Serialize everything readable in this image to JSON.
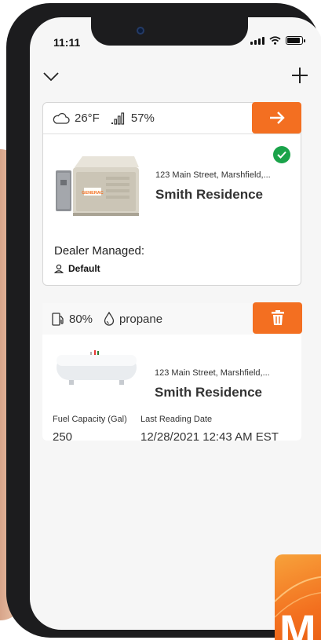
{
  "status_bar": {
    "time": "11:11"
  },
  "nav": {
    "collapse_icon": "chevron-down-icon",
    "add_icon": "plus-icon"
  },
  "generator_card": {
    "weather_icon": "cloud-icon",
    "temperature": "26°F",
    "signal_icon": "signal-bars-icon",
    "signal_strength": "57%",
    "action_icon": "arrow-right-icon",
    "address": "123 Main Street, Marshfield,...",
    "residence": "Smith Residence",
    "status_icon": "check-circle-icon",
    "brand_text": "GENERAC",
    "dealer_label": "Dealer Managed:",
    "dealer_value": "Default",
    "dealer_icon": "user-icon"
  },
  "fuel_card": {
    "fuel_icon": "fuel-pump-icon",
    "fuel_level": "80%",
    "drop_icon": "drop-icon",
    "fuel_type": "propane",
    "action_icon": "trash-icon",
    "address": "123 Main Street, Marshfield,...",
    "residence": "Smith Residence",
    "capacity_label": "Fuel Capacity (Gal)",
    "capacity_value": "250",
    "reading_label": "Last Reading Date",
    "reading_value": "12/28/2021 12:43 AM EST"
  },
  "brand_tile": {
    "letter": "M"
  },
  "colors": {
    "accent": "#f36f21",
    "success": "#1aa34a",
    "phone": "#1c1c1e"
  }
}
